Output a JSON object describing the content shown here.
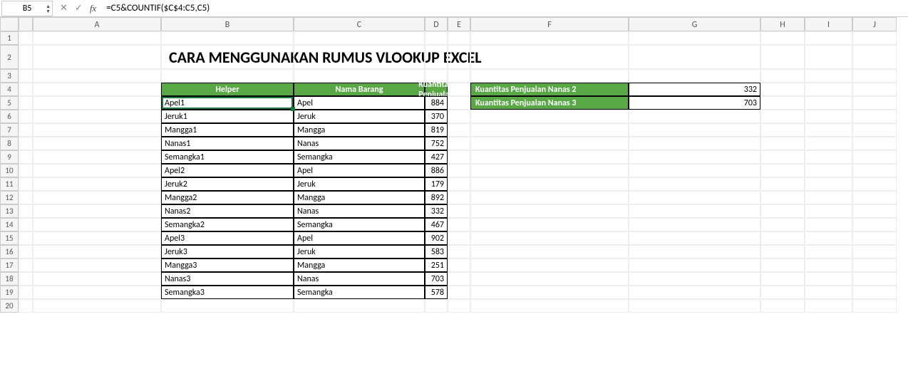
{
  "name_box": "B5",
  "formula": "=C5&COUNTIF($C$4:C5,C5)",
  "columns": [
    "A",
    "B",
    "C",
    "D",
    "E",
    "F",
    "G",
    "H",
    "I",
    "J"
  ],
  "rows": [
    "1",
    "2",
    "3",
    "4",
    "5",
    "6",
    "7",
    "8",
    "9",
    "10",
    "11",
    "12",
    "13",
    "14",
    "15",
    "16",
    "17",
    "18",
    "19",
    "20"
  ],
  "title": "CARA MENGGUNAKAN RUMUS VLOOKUP EXCEL",
  "table_headers": {
    "helper": "Helper",
    "nama": "Nama Barang",
    "kuantitas": "Kuantitas Penjualan"
  },
  "table_rows": [
    {
      "helper": "Apel1",
      "nama": "Apel",
      "qty": 884
    },
    {
      "helper": "Jeruk1",
      "nama": "Jeruk",
      "qty": 370
    },
    {
      "helper": "Mangga1",
      "nama": "Mangga",
      "qty": 819
    },
    {
      "helper": "Nanas1",
      "nama": "Nanas",
      "qty": 752
    },
    {
      "helper": "Semangka1",
      "nama": "Semangka",
      "qty": 427
    },
    {
      "helper": "Apel2",
      "nama": "Apel",
      "qty": 886
    },
    {
      "helper": "Jeruk2",
      "nama": "Jeruk",
      "qty": 179
    },
    {
      "helper": "Mangga2",
      "nama": "Mangga",
      "qty": 892
    },
    {
      "helper": "Nanas2",
      "nama": "Nanas",
      "qty": 332
    },
    {
      "helper": "Semangka2",
      "nama": "Semangka",
      "qty": 467
    },
    {
      "helper": "Apel3",
      "nama": "Apel",
      "qty": 902
    },
    {
      "helper": "Jeruk3",
      "nama": "Jeruk",
      "qty": 583
    },
    {
      "helper": "Mangga3",
      "nama": "Mangga",
      "qty": 251
    },
    {
      "helper": "Nanas3",
      "nama": "Nanas",
      "qty": 703
    },
    {
      "helper": "Semangka3",
      "nama": "Semangka",
      "qty": 578
    }
  ],
  "lookup": [
    {
      "label": "Kuantitas Penjualan Nanas 2",
      "value": 332
    },
    {
      "label": "Kuantitas Penjualan Nanas 3",
      "value": 703
    }
  ],
  "colors": {
    "green": "#58a846",
    "selection": "#1a7a3d"
  }
}
